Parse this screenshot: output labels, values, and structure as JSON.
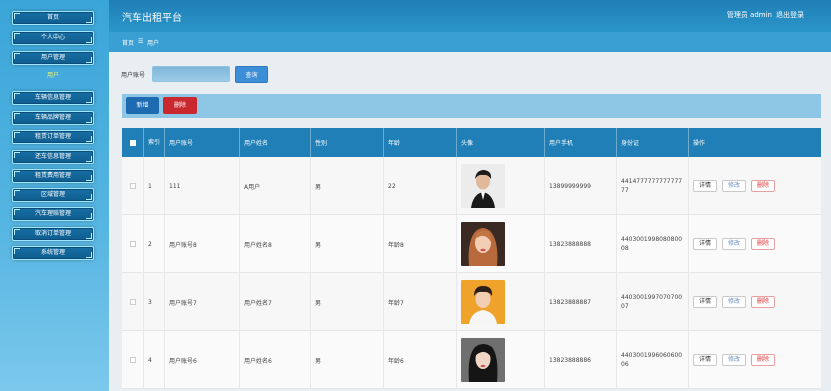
{
  "header": {
    "title": "汽车出租平台",
    "user": "管理员 admin",
    "logout": "退出登录"
  },
  "breadcrumb": {
    "home": "首页",
    "sep": "☰",
    "current": "用户"
  },
  "sidebar": {
    "items": [
      {
        "label": "首页"
      },
      {
        "label": "个人中心"
      },
      {
        "label": "用户管理"
      },
      {
        "label": "用户"
      },
      {
        "label": "车辆信息管理"
      },
      {
        "label": "车辆品牌管理"
      },
      {
        "label": "租赁订单管理"
      },
      {
        "label": "还车信息管理"
      },
      {
        "label": "租赁费用管理"
      },
      {
        "label": "区域管理"
      },
      {
        "label": "汽车理赔管理"
      },
      {
        "label": "取消订单管理"
      },
      {
        "label": "系统管理"
      }
    ]
  },
  "search": {
    "label": "用户账号",
    "value": "",
    "button": "查询"
  },
  "actions": {
    "add": "新增",
    "delete": "删除"
  },
  "table": {
    "headers": [
      "索引",
      "用户账号",
      "用户姓名",
      "性别",
      "年龄",
      "头像",
      "用户手机",
      "身份证",
      "操作"
    ],
    "rows": [
      {
        "index": "1",
        "account": "111",
        "name": "A用户",
        "gender": "男",
        "age": "22",
        "phone": "13899999999",
        "id_card": "441477777777777777",
        "avatar": "portrait-man-suit"
      },
      {
        "index": "2",
        "account": "用户账号8",
        "name": "用户姓名8",
        "gender": "男",
        "age": "年龄8",
        "phone": "13823888888",
        "id_card": "440300199808080008",
        "avatar": "portrait-woman-long-hair"
      },
      {
        "index": "3",
        "account": "用户账号7",
        "name": "用户姓名7",
        "gender": "男",
        "age": "年龄7",
        "phone": "13823888887",
        "id_card": "440300199707070007",
        "avatar": "portrait-man-orange"
      },
      {
        "index": "4",
        "account": "用户账号6",
        "name": "用户姓名6",
        "gender": "男",
        "age": "年龄6",
        "phone": "13823888886",
        "id_card": "440300199606060006",
        "avatar": "portrait-woman-dark-hair"
      }
    ],
    "ops": {
      "detail": "详情",
      "edit": "修改",
      "remove": "删除"
    }
  },
  "colors": {
    "header": "#1f7fb6",
    "sidebar": "#3aa5d8",
    "add": "#1f6bb2",
    "delete": "#c8282e",
    "search": "#3c8fd6"
  }
}
